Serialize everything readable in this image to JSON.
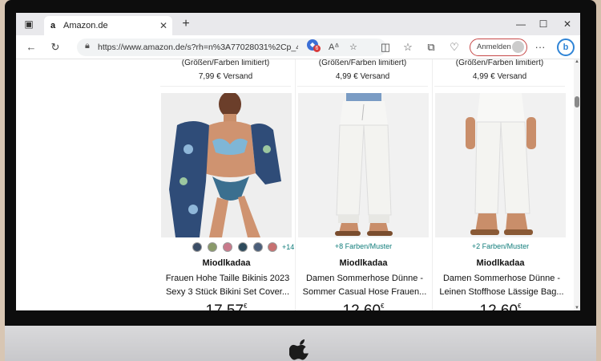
{
  "browser": {
    "tab_title": "Amazon.de",
    "tab_favicon": "a",
    "url": "https://www.amazon.de/s?rh=n%3A77028031%2Cp_4%...",
    "ext_badge_count": "6",
    "signin_label": "Anmelden"
  },
  "results": {
    "prev_row": [
      {
        "note": "(Größen/Farben limitiert)",
        "shipping": "7,99 € Versand"
      },
      {
        "note": "(Größen/Farben limitiert)",
        "shipping": "4,99 € Versand"
      },
      {
        "note": "(Größen/Farben limitiert)",
        "shipping": "4,99 € Versand"
      }
    ],
    "products": [
      {
        "variants": "",
        "swatch_more": "+14",
        "swatch_colors": [
          "#3a4d66",
          "#8a9a6a",
          "#c97a8c",
          "#2d4a5c",
          "#4b5f7a",
          "#c77070"
        ],
        "brand": "Miodlkadaa",
        "title_line1": "Frauen Hohe Taille Bikinis 2023",
        "title_line2": "Sexy 3 Stück Bikini Set Cover...",
        "price": "17,57",
        "currency": "€"
      },
      {
        "variants": "+8 Farben/Muster",
        "brand": "Miodlkadaa",
        "title_line1": "Damen Sommerhose Dünne -",
        "title_line2": "Sommer Casual Hose Frauen...",
        "price": "12,60",
        "currency": "€"
      },
      {
        "variants": "+2 Farben/Muster",
        "brand": "Miodlkadaa",
        "title_line1": "Damen Sommerhose Dünne -",
        "title_line2": "Leinen Stoffhose Lässige Bag...",
        "price": "12,60",
        "currency": "€"
      }
    ]
  }
}
